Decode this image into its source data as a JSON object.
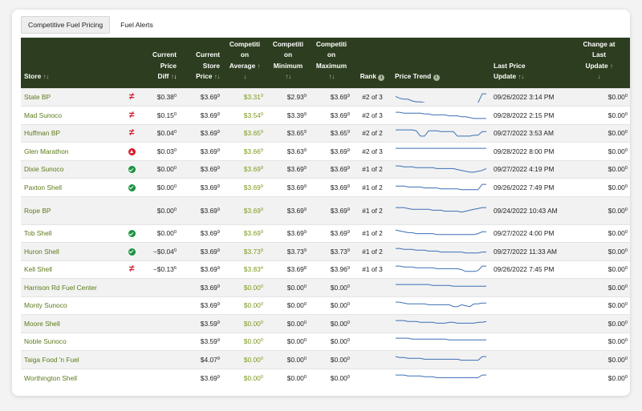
{
  "tabs": [
    {
      "label": "Competitive Fuel Pricing",
      "active": true
    },
    {
      "label": "Fuel Alerts",
      "active": false
    }
  ],
  "headers": {
    "store": "Store",
    "current_price_diff": [
      "Current",
      "Price",
      "Diff"
    ],
    "current_store_price": [
      "Current",
      "Store",
      "Price"
    ],
    "competition_average": [
      "Competiti",
      "on",
      "Average"
    ],
    "competition_minimum": [
      "Competiti",
      "on",
      "Minimum"
    ],
    "competition_maximum": [
      "Competiti",
      "on",
      "Maximum"
    ],
    "rank": "Rank",
    "price_trend": "Price Trend",
    "last_price_update": [
      "Last Price",
      "Update"
    ],
    "change_at_last_update": [
      "Change at",
      "Last",
      "Update"
    ]
  },
  "rows": [
    {
      "store": "State BP",
      "status": "not-equal",
      "diff": "$0.38",
      "diff_sup": "0",
      "price": "$3.69",
      "price_sup": "9",
      "avg": "$3.31",
      "avg_sup": "9",
      "min": "$2.93",
      "min_sup": "9",
      "max": "$3.69",
      "max_sup": "9",
      "rank": "#2 of 3",
      "trend": [
        3.69,
        3.67,
        3.66,
        3.66,
        3.64,
        3.63,
        3.63,
        3.62,
        3.6,
        3.6,
        3.61,
        3.6,
        3.6,
        3.6,
        3.6,
        3.6,
        3.61,
        3.6,
        3.6,
        3.6,
        3.62,
        3.72,
        3.72
      ],
      "updated": "09/26/2022 3:14 PM",
      "change": "$0.00",
      "change_sup": "0"
    },
    {
      "store": "Mad Sunoco",
      "status": "not-equal",
      "diff": "$0.15",
      "diff_sup": "0",
      "price": "$3.69",
      "price_sup": "9",
      "avg": "$3.54",
      "avg_sup": "9",
      "min": "$3.39",
      "min_sup": "9",
      "max": "$3.69",
      "max_sup": "9",
      "rank": "#2 of 3",
      "trend": [
        3.72,
        3.72,
        3.71,
        3.71,
        3.71,
        3.71,
        3.71,
        3.7,
        3.7,
        3.69,
        3.69,
        3.69,
        3.69,
        3.68,
        3.68,
        3.68,
        3.67,
        3.67,
        3.66,
        3.65,
        3.65,
        3.65,
        3.65
      ],
      "updated": "09/28/2022 2:15 PM",
      "change": "$0.00",
      "change_sup": "0"
    },
    {
      "store": "Huffman BP",
      "status": "not-equal",
      "diff": "$0.04",
      "diff_sup": "0",
      "price": "$3.69",
      "price_sup": "9",
      "avg": "$3.65",
      "avg_sup": "9",
      "min": "$3.65",
      "min_sup": "9",
      "max": "$3.65",
      "max_sup": "9",
      "rank": "#2 of 2",
      "trend": [
        3.72,
        3.72,
        3.72,
        3.72,
        3.72,
        3.71,
        3.65,
        3.65,
        3.71,
        3.71,
        3.71,
        3.7,
        3.7,
        3.7,
        3.7,
        3.65,
        3.65,
        3.65,
        3.65,
        3.66,
        3.66,
        3.7,
        3.7
      ],
      "updated": "09/27/2022 3:53 AM",
      "change": "$0.00",
      "change_sup": "0"
    },
    {
      "store": "Glen Marathon",
      "status": "up",
      "diff": "$0.03",
      "diff_sup": "0",
      "price": "$3.69",
      "price_sup": "9",
      "avg": "$3.66",
      "avg_sup": "9",
      "min": "$3.63",
      "min_sup": "9",
      "max": "$3.69",
      "max_sup": "9",
      "rank": "#2 of 3",
      "trend": [
        3.72,
        3.72,
        3.72,
        3.72,
        3.72,
        3.72,
        3.72,
        3.72,
        3.72,
        3.72,
        3.72,
        3.72,
        3.72,
        3.72,
        3.72,
        3.72,
        3.72,
        3.72,
        3.72,
        3.72,
        3.72,
        3.72,
        3.72
      ],
      "updated": "09/28/2022 8:00 PM",
      "change": "$0.00",
      "change_sup": "0"
    },
    {
      "store": "Dixie Sunoco",
      "status": "check",
      "diff": "$0.00",
      "diff_sup": "0",
      "price": "$3.69",
      "price_sup": "9",
      "avg": "$3.69",
      "avg_sup": "9",
      "min": "$3.69",
      "min_sup": "9",
      "max": "$3.69",
      "max_sup": "9",
      "rank": "#1 of 2",
      "trend": [
        3.72,
        3.72,
        3.71,
        3.71,
        3.71,
        3.7,
        3.7,
        3.7,
        3.7,
        3.7,
        3.69,
        3.69,
        3.69,
        3.69,
        3.69,
        3.68,
        3.67,
        3.66,
        3.65,
        3.65,
        3.66,
        3.67,
        3.69
      ],
      "updated": "09/27/2022 4:19 PM",
      "change": "$0.00",
      "change_sup": "0"
    },
    {
      "store": "Paxton Shell",
      "status": "check",
      "diff": "$0.00",
      "diff_sup": "0",
      "price": "$3.69",
      "price_sup": "9",
      "avg": "$3.69",
      "avg_sup": "9",
      "min": "$3.69",
      "min_sup": "9",
      "max": "$3.69",
      "max_sup": "9",
      "rank": "#1 of 2",
      "trend": [
        3.7,
        3.7,
        3.7,
        3.69,
        3.69,
        3.69,
        3.69,
        3.68,
        3.68,
        3.68,
        3.68,
        3.67,
        3.67,
        3.67,
        3.67,
        3.67,
        3.66,
        3.66,
        3.66,
        3.66,
        3.66,
        3.72,
        3.72
      ],
      "updated": "09/26/2022 7:49 PM",
      "change": "$0.00",
      "change_sup": "0"
    },
    {
      "store": "Rope BP",
      "status": "",
      "diff": "$0.00",
      "diff_sup": "0",
      "price": "$3.69",
      "price_sup": "9",
      "avg": "$3.69",
      "avg_sup": "9",
      "min": "$3.69",
      "min_sup": "9",
      "max": "$3.69",
      "max_sup": "9",
      "rank": "#1 of 2",
      "trend": [
        3.72,
        3.72,
        3.72,
        3.71,
        3.7,
        3.7,
        3.7,
        3.7,
        3.7,
        3.69,
        3.69,
        3.69,
        3.68,
        3.68,
        3.68,
        3.68,
        3.67,
        3.68,
        3.69,
        3.7,
        3.71,
        3.72,
        3.72
      ],
      "updated": "09/24/2022 10:43 AM",
      "change": "$0.00",
      "change_sup": "0",
      "tall": true
    },
    {
      "store": "Tob Shell",
      "status": "check",
      "diff": "$0.00",
      "diff_sup": "0",
      "price": "$3.69",
      "price_sup": "9",
      "avg": "$3.69",
      "avg_sup": "9",
      "min": "$3.69",
      "min_sup": "9",
      "max": "$3.69",
      "max_sup": "9",
      "rank": "#1 of 2",
      "trend": [
        3.72,
        3.71,
        3.7,
        3.69,
        3.69,
        3.68,
        3.68,
        3.68,
        3.68,
        3.68,
        3.67,
        3.67,
        3.67,
        3.67,
        3.67,
        3.67,
        3.67,
        3.67,
        3.67,
        3.67,
        3.68,
        3.7,
        3.7
      ],
      "updated": "09/27/2022 4:00 PM",
      "change": "$0.00",
      "change_sup": "0"
    },
    {
      "store": "Huron Shell",
      "status": "check",
      "diff": "−$0.04",
      "diff_sup": "0",
      "price": "$3.69",
      "price_sup": "9",
      "avg": "$3.73",
      "avg_sup": "9",
      "min": "$3.73",
      "min_sup": "9",
      "max": "$3.73",
      "max_sup": "9",
      "rank": "#1 of 2",
      "trend": [
        3.72,
        3.72,
        3.71,
        3.71,
        3.71,
        3.7,
        3.7,
        3.7,
        3.69,
        3.69,
        3.69,
        3.68,
        3.68,
        3.68,
        3.68,
        3.68,
        3.68,
        3.67,
        3.67,
        3.67,
        3.67,
        3.68,
        3.68
      ],
      "updated": "09/27/2022 11:33 AM",
      "change": "$0.00",
      "change_sup": "0"
    },
    {
      "store": "Kell Shell",
      "status": "not-equal",
      "diff": "−$0.13",
      "diff_sup": "6",
      "price": "$3.69",
      "price_sup": "9",
      "avg": "$3.83",
      "avg_sup": "4",
      "min": "$3.69",
      "min_sup": "8",
      "max": "$3.96",
      "max_sup": "9",
      "rank": "#1 of 3",
      "trend": [
        3.72,
        3.72,
        3.71,
        3.71,
        3.71,
        3.7,
        3.7,
        3.7,
        3.7,
        3.7,
        3.69,
        3.69,
        3.69,
        3.69,
        3.69,
        3.69,
        3.68,
        3.66,
        3.66,
        3.66,
        3.67,
        3.72,
        3.72
      ],
      "updated": "09/26/2022 7:45 PM",
      "change": "$0.00",
      "change_sup": "0"
    },
    {
      "store": "Harrison Rd Fuel Center",
      "status": "",
      "diff": "",
      "diff_sup": "",
      "price": "$3.69",
      "price_sup": "9",
      "avg": "$0.00",
      "avg_sup": "0",
      "min": "$0.00",
      "min_sup": "0",
      "max": "$0.00",
      "max_sup": "0",
      "rank": "",
      "trend": [
        3.72,
        3.72,
        3.72,
        3.72,
        3.72,
        3.72,
        3.72,
        3.72,
        3.72,
        3.71,
        3.71,
        3.71,
        3.71,
        3.71,
        3.7,
        3.7,
        3.7,
        3.7,
        3.7,
        3.7,
        3.7,
        3.7,
        3.7
      ],
      "updated": "",
      "change": "$0.00",
      "change_sup": "0"
    },
    {
      "store": "Monty Sunoco",
      "status": "",
      "diff": "",
      "diff_sup": "",
      "price": "$3.69",
      "price_sup": "9",
      "avg": "$0.00",
      "avg_sup": "0",
      "min": "$0.00",
      "min_sup": "0",
      "max": "$0.00",
      "max_sup": "0",
      "rank": "",
      "trend": [
        3.72,
        3.72,
        3.71,
        3.7,
        3.7,
        3.7,
        3.7,
        3.7,
        3.69,
        3.69,
        3.69,
        3.69,
        3.69,
        3.69,
        3.67,
        3.67,
        3.69,
        3.68,
        3.67,
        3.7,
        3.7,
        3.71,
        3.71
      ],
      "updated": "",
      "change": "$0.00",
      "change_sup": "0"
    },
    {
      "store": "Moore Shell",
      "status": "",
      "diff": "",
      "diff_sup": "",
      "price": "$3.59",
      "price_sup": "9",
      "avg": "$0.00",
      "avg_sup": "0",
      "min": "$0.00",
      "min_sup": "0",
      "max": "$0.00",
      "max_sup": "0",
      "rank": "",
      "trend": [
        3.72,
        3.72,
        3.72,
        3.71,
        3.71,
        3.71,
        3.7,
        3.7,
        3.7,
        3.7,
        3.69,
        3.69,
        3.69,
        3.7,
        3.7,
        3.69,
        3.69,
        3.69,
        3.69,
        3.69,
        3.7,
        3.7,
        3.71
      ],
      "updated": "",
      "change": "$0.00",
      "change_sup": "0"
    },
    {
      "store": "Noble Sunoco",
      "status": "",
      "diff": "",
      "diff_sup": "",
      "price": "$3.59",
      "price_sup": "9",
      "avg": "$0.00",
      "avg_sup": "0",
      "min": "$0.00",
      "min_sup": "0",
      "max": "$0.00",
      "max_sup": "0",
      "rank": "",
      "trend": [
        3.72,
        3.72,
        3.72,
        3.72,
        3.71,
        3.71,
        3.71,
        3.71,
        3.71,
        3.71,
        3.71,
        3.71,
        3.71,
        3.7,
        3.7,
        3.7,
        3.7,
        3.7,
        3.7,
        3.7,
        3.7,
        3.7,
        3.7
      ],
      "updated": "",
      "change": "$0.00",
      "change_sup": "0"
    },
    {
      "store": "Taiga Food 'n Fuel",
      "status": "",
      "diff": "",
      "diff_sup": "",
      "price": "$4.07",
      "price_sup": "9",
      "avg": "$0.00",
      "avg_sup": "0",
      "min": "$0.00",
      "min_sup": "0",
      "max": "$0.00",
      "max_sup": "0",
      "rank": "",
      "trend": [
        3.72,
        3.71,
        3.71,
        3.7,
        3.7,
        3.7,
        3.7,
        3.69,
        3.69,
        3.69,
        3.69,
        3.69,
        3.69,
        3.69,
        3.69,
        3.69,
        3.68,
        3.68,
        3.68,
        3.68,
        3.68,
        3.72,
        3.72
      ],
      "updated": "",
      "change": "$0.00",
      "change_sup": "0"
    },
    {
      "store": "Worthington Shell",
      "status": "",
      "diff": "",
      "diff_sup": "",
      "price": "$3.69",
      "price_sup": "9",
      "avg": "$0.00",
      "avg_sup": "0",
      "min": "$0.00",
      "min_sup": "0",
      "max": "$0.00",
      "max_sup": "0",
      "rank": "",
      "trend": [
        3.72,
        3.72,
        3.72,
        3.71,
        3.71,
        3.71,
        3.71,
        3.7,
        3.7,
        3.7,
        3.69,
        3.69,
        3.69,
        3.69,
        3.69,
        3.69,
        3.69,
        3.69,
        3.69,
        3.69,
        3.69,
        3.72,
        3.72
      ],
      "updated": "",
      "change": "$0.00",
      "change_sup": "0"
    }
  ],
  "colors": {
    "header_bg": "#2d3d1f",
    "link": "#5b7a1a",
    "accent_green": "#7a9a1c",
    "trend_line": "#3d6fb5",
    "check": "#1c9440",
    "alert_red": "#d81d2d"
  },
  "icons": {
    "check": "check-circle-icon",
    "up": "arrow-up-circle-icon",
    "not-equal": "not-equal-icon",
    "info": "info-icon"
  }
}
